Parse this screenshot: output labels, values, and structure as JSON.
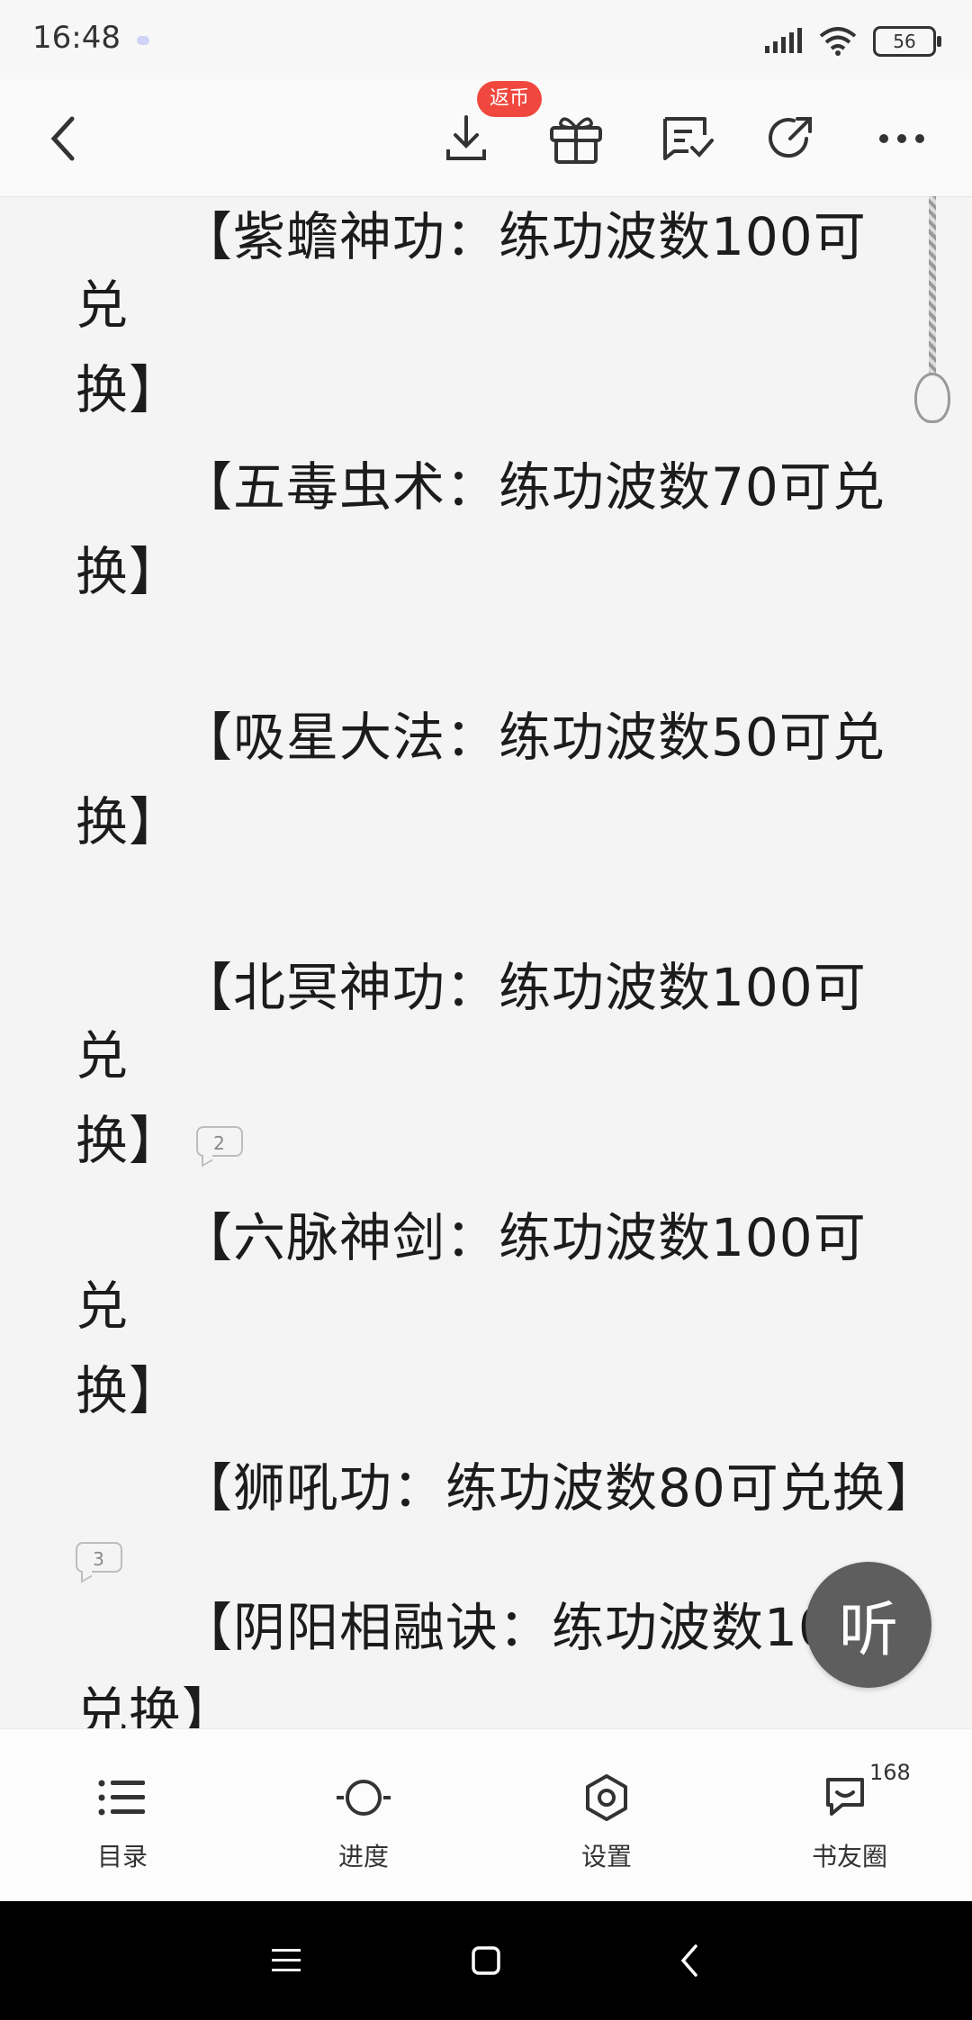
{
  "status_bar": {
    "time": "16:48",
    "battery": "56"
  },
  "toolbar": {
    "rebate_badge": "返币"
  },
  "content": {
    "paragraphs": [
      {
        "line1": "【紫蟾神功：练功波数100可兑",
        "line2": "换】",
        "comments": ""
      },
      {
        "line1": "【五毒虫术：练功波数70可兑",
        "line2": "换】",
        "comments": ""
      },
      {
        "line1": "【吸星大法：练功波数50可兑",
        "line2": "换】",
        "comments": ""
      },
      {
        "line1": "【北冥神功：练功波数100可兑",
        "line2": "换】",
        "comments": "2"
      },
      {
        "line1": "【六脉神剑：练功波数100可兑",
        "line2": "换】",
        "comments": ""
      },
      {
        "line1": "【狮吼功：练功波数80可兑换】",
        "line2": "",
        "comments": "3"
      },
      {
        "line1": "【阴阳相融诀：练功波数10",
        "line2": "兑换】",
        "comments": ""
      }
    ]
  },
  "listen_button": {
    "label": "听"
  },
  "bottom_nav": {
    "items": [
      {
        "label": "目录",
        "icon": "list-icon"
      },
      {
        "label": "进度",
        "icon": "progress-icon"
      },
      {
        "label": "设置",
        "icon": "settings-icon"
      },
      {
        "label": "书友圈",
        "icon": "community-icon",
        "count": "168"
      }
    ]
  }
}
